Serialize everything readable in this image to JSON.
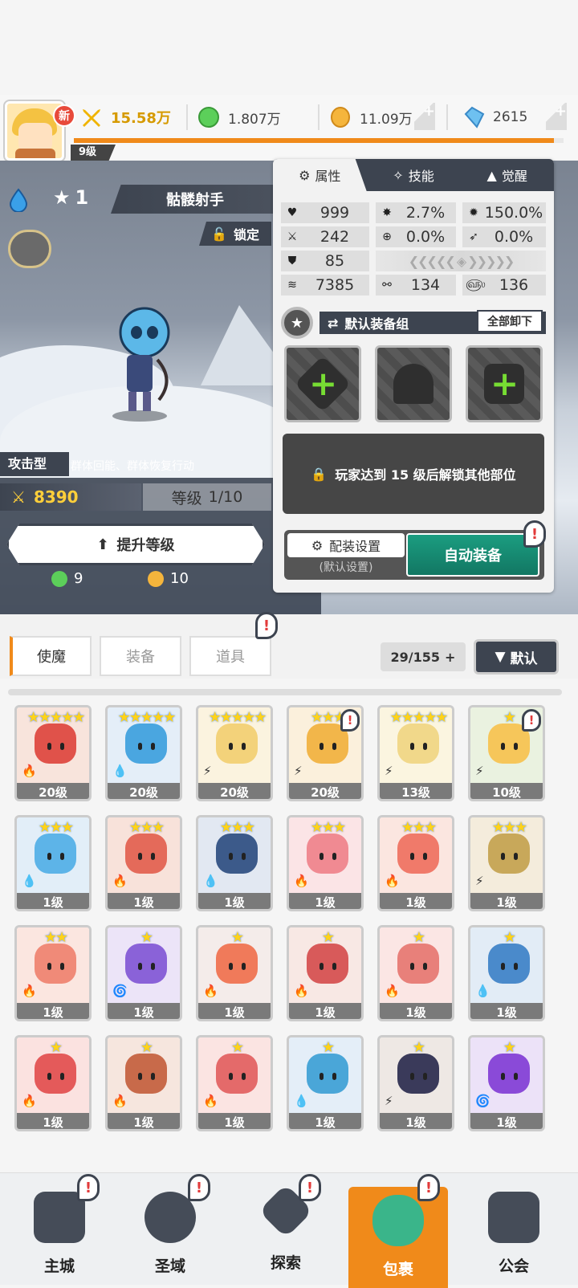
{
  "player": {
    "new_badge": "新",
    "power": "15.58万",
    "level": "9级",
    "xp_fraction": 0.98
  },
  "resources": [
    {
      "icon": "green-gem-icon",
      "value": "1.807万"
    },
    {
      "icon": "gold-coin-icon",
      "value": "11.09万"
    },
    {
      "icon": "blue-crystal-icon",
      "value": "2615"
    }
  ],
  "hero": {
    "star": "1",
    "name": "骷髅射手",
    "lock_label": "锁定",
    "role": "攻击型",
    "role_desc": "群体回能、群体恢复行动",
    "power": "8390",
    "level_label": "等级",
    "level_value": "1/10",
    "upgrade_label": "提升等级",
    "cost_green": "9",
    "cost_gold": "10"
  },
  "panel": {
    "tabs": [
      "属性",
      "技能",
      "觉醒"
    ],
    "stats": {
      "hp": "999",
      "crit": "2.7%",
      "crit_dmg": "150.0%",
      "atk": "242",
      "hit": "0.0%",
      "dodge": "0.0%",
      "def": "85",
      "speed": "7385",
      "s1": "134",
      "s2": "136"
    },
    "equip_group": "默认装备组",
    "unequip_all": "全部卸下",
    "locked_msg": "玩家达到 15 级后解锁其他部位",
    "config_label": "配装设置",
    "config_sub": "(默认设置)",
    "auto_equip": "自动装备"
  },
  "inventory": {
    "tabs": [
      "使魔",
      "装备",
      "道具"
    ],
    "count": "29/155",
    "sort": "默认",
    "cards": [
      {
        "stars": "★★★★★",
        "level": "20级",
        "color": "#e0524a",
        "bg": "#f8e4dc",
        "elem": "🔥",
        "alert": false
      },
      {
        "stars": "★★★★★",
        "level": "20级",
        "color": "#4aa6e0",
        "bg": "#e4eef8",
        "elem": "💧",
        "alert": false
      },
      {
        "stars": "★★★★★",
        "level": "20级",
        "color": "#f3d27a",
        "bg": "#fbf3df",
        "elem": "⚡",
        "alert": false
      },
      {
        "stars": "★★★",
        "level": "20级",
        "color": "#f2b64a",
        "bg": "#fbf0dc",
        "elem": "⚡",
        "alert": true
      },
      {
        "stars": "★★★★★",
        "level": "13级",
        "color": "#f1d88a",
        "bg": "#fbf5e0",
        "elem": "⚡",
        "alert": false
      },
      {
        "stars": "★",
        "level": "10级",
        "color": "#f6c65a",
        "bg": "#eaf2e0",
        "elem": "⚡",
        "alert": true
      },
      {
        "stars": "★★★",
        "level": "1级",
        "color": "#5db4e8",
        "bg": "#e2eef8",
        "elem": "💧",
        "alert": false
      },
      {
        "stars": "★★★",
        "level": "1级",
        "color": "#e46a5a",
        "bg": "#f8e2da",
        "elem": "🔥",
        "alert": false
      },
      {
        "stars": "★★★",
        "level": "1级",
        "color": "#3c5a8a",
        "bg": "#e2e8f2",
        "elem": "💧",
        "alert": false
      },
      {
        "stars": "★★★",
        "level": "1级",
        "color": "#f08a92",
        "bg": "#fbe4e6",
        "elem": "🔥",
        "alert": false
      },
      {
        "stars": "★★★",
        "level": "1级",
        "color": "#f07a6a",
        "bg": "#fbe6e0",
        "elem": "🔥",
        "alert": false
      },
      {
        "stars": "★★★",
        "level": "1级",
        "color": "#c8a85a",
        "bg": "#f4ecdc",
        "elem": "⚡",
        "alert": false
      },
      {
        "stars": "★★",
        "level": "1级",
        "color": "#f08a78",
        "bg": "#fbe6e0",
        "elem": "🔥",
        "alert": false
      },
      {
        "stars": "★",
        "level": "1级",
        "color": "#8a62d8",
        "bg": "#ece4f8",
        "elem": "🌀",
        "alert": false
      },
      {
        "stars": "★",
        "level": "1级",
        "color": "#f07a5a",
        "bg": "#f4ecea",
        "elem": "🔥",
        "alert": false
      },
      {
        "stars": "★",
        "level": "1级",
        "color": "#d85a5a",
        "bg": "#f8e8e4",
        "elem": "🔥",
        "alert": false
      },
      {
        "stars": "★",
        "level": "1级",
        "color": "#e8807a",
        "bg": "#fbe6e4",
        "elem": "🔥",
        "alert": false
      },
      {
        "stars": "★",
        "level": "1级",
        "color": "#4a8acb",
        "bg": "#e2ecf6",
        "elem": "💧",
        "alert": false
      },
      {
        "stars": "★",
        "level": "1级",
        "color": "#e45a5a",
        "bg": "#fbe2e0",
        "elem": "🔥",
        "alert": false
      },
      {
        "stars": "★",
        "level": "1级",
        "color": "#c86a4a",
        "bg": "#f6e6de",
        "elem": "🔥",
        "alert": false
      },
      {
        "stars": "★",
        "level": "1级",
        "color": "#e46a6a",
        "bg": "#fbe4e2",
        "elem": "🔥",
        "alert": false
      },
      {
        "stars": "★",
        "level": "1级",
        "color": "#4aa6d8",
        "bg": "#e4eef8",
        "elem": "💧",
        "alert": false
      },
      {
        "stars": "★",
        "level": "1级",
        "color": "#3a3a5a",
        "bg": "#eee8e4",
        "elem": "⚡",
        "alert": false
      },
      {
        "stars": "★",
        "level": "1级",
        "color": "#8a4ad8",
        "bg": "#ece2f8",
        "elem": "🌀",
        "alert": false
      }
    ]
  },
  "nav": [
    {
      "label": "主城",
      "icon": "castle-icon",
      "alert": true
    },
    {
      "label": "圣域",
      "icon": "vortex-icon",
      "alert": true
    },
    {
      "label": "探索",
      "icon": "sword-icon",
      "alert": true
    },
    {
      "label": "包裹",
      "icon": "bag-icon",
      "alert": true,
      "active": true
    },
    {
      "label": "公会",
      "icon": "guild-icon",
      "alert": false
    }
  ],
  "colors": {
    "accent": "#f08a1a",
    "dark": "#3d4450",
    "teal": "#1b9d80"
  }
}
